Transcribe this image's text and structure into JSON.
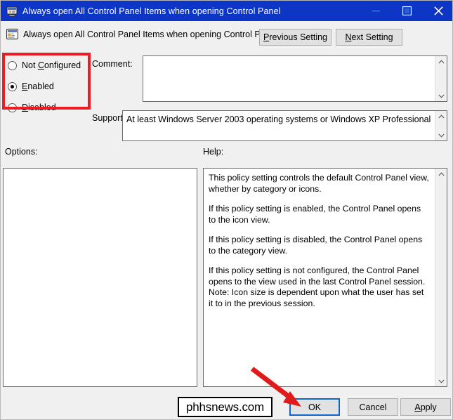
{
  "window": {
    "title": "Always open All Control Panel Items when opening Control Panel",
    "icon": "policy-setting-icon",
    "minimize_label": "minimize-icon",
    "maximize_label": "maximize-icon",
    "close_label": "close-icon",
    "titlebar_color": "#0e36c6"
  },
  "header": {
    "icon": "policy-document-icon",
    "title": "Always open All Control Panel Items when opening Control Panel",
    "previous_setting": "Previous Setting",
    "previous_setting_mnemonic": "P",
    "next_setting": "Next Setting",
    "next_setting_mnemonic": "N"
  },
  "state": {
    "options": [
      {
        "label": "Not Configured",
        "mnemonic": "C",
        "selected": false
      },
      {
        "label": "Enabled",
        "mnemonic": "E",
        "selected": true
      },
      {
        "label": "Disabled",
        "mnemonic": "D",
        "selected": false
      }
    ],
    "highlight_color": "#ee1b24"
  },
  "fields": {
    "comment_label": "Comment:",
    "comment_value": "",
    "supported_label": "Supported on:",
    "supported_value": "At least Windows Server 2003 operating systems or Windows XP Professional"
  },
  "panels": {
    "options_label": "Options:",
    "options_content": "",
    "help_label": "Help:",
    "help_paragraphs": [
      "This policy setting controls the default Control Panel view, whether by category or icons.",
      "If this policy setting is enabled, the Control Panel opens to the icon view.",
      "If this policy setting is disabled, the Control Panel opens to the category view.",
      "If this policy setting is not configured, the Control Panel opens to the view used in the last Control Panel session.",
      "Note: Icon size is dependent upon what the user has set it to in the previous session."
    ]
  },
  "buttons": {
    "ok": "OK",
    "cancel": "Cancel",
    "apply": "Apply",
    "apply_mnemonic": "A",
    "ok_focused": true,
    "focus_color": "#0a63ce"
  },
  "annotations": {
    "watermark": "phhsnews.com",
    "arrow_color": "#e01b1b",
    "arrow_target": "ok-button"
  }
}
